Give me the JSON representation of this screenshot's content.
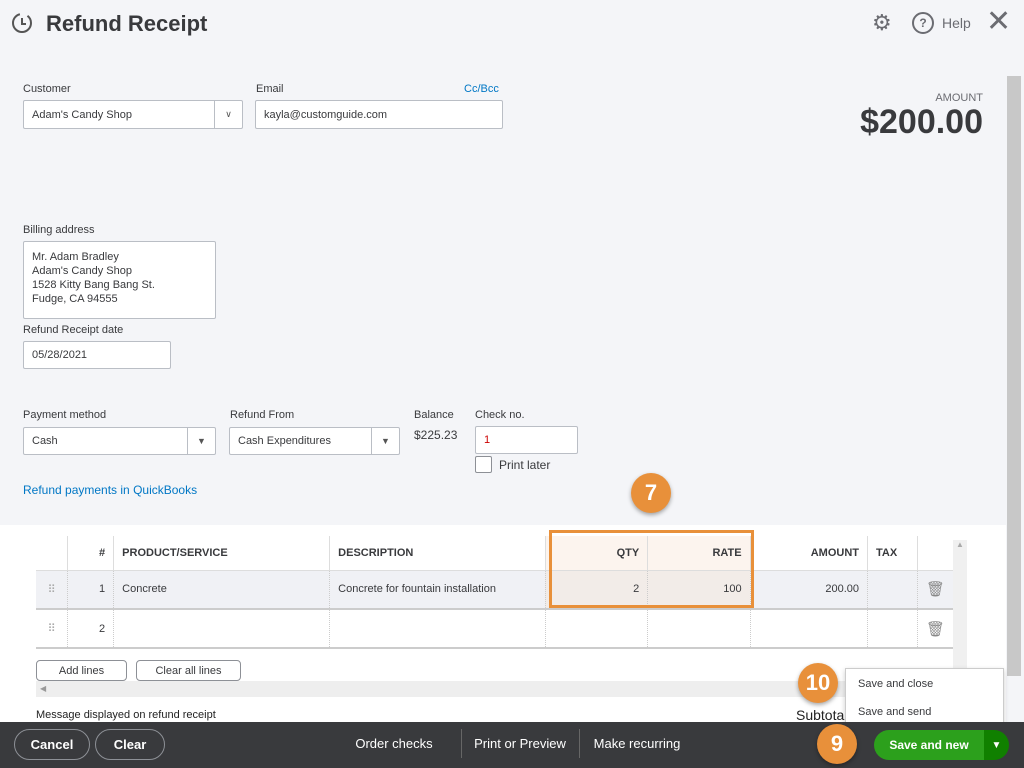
{
  "header": {
    "title": "Refund Receipt",
    "help": "Help"
  },
  "form": {
    "customer_label": "Customer",
    "customer": "Adam's Candy Shop",
    "email_label": "Email",
    "email": "kayla@customguide.com",
    "ccbcc": "Cc/Bcc",
    "amount_label": "AMOUNT",
    "amount": "$200.00",
    "billing_label": "Billing address",
    "billing": [
      "Mr. Adam Bradley",
      "Adam's Candy Shop",
      "1528 Kitty Bang Bang St.",
      "Fudge, CA  94555"
    ],
    "date_label": "Refund Receipt date",
    "date": "05/28/2021",
    "payment_label": "Payment method",
    "payment": "Cash",
    "refund_from_label": "Refund From",
    "refund_from": "Cash Expenditures",
    "balance_label": "Balance",
    "balance": "$225.23",
    "check_label": "Check no.",
    "check": "1",
    "print_later": "Print later",
    "link": "Refund payments in QuickBooks"
  },
  "table": {
    "headers": [
      "#",
      "PRODUCT/SERVICE",
      "DESCRIPTION",
      "QTY",
      "RATE",
      "AMOUNT",
      "TAX"
    ],
    "rows": [
      {
        "n": "1",
        "product": "Concrete",
        "description": "Concrete for fountain installation",
        "qty": "2",
        "rate": "100",
        "amount": "200.00"
      },
      {
        "n": "2",
        "product": "",
        "description": "",
        "qty": "",
        "rate": "",
        "amount": ""
      }
    ],
    "add_lines": "Add lines",
    "clear_lines": "Clear all lines"
  },
  "message_label": "Message displayed on refund receipt",
  "subtotal": "Subtotal",
  "menu": {
    "items": [
      "Save and close",
      "Save and send"
    ]
  },
  "footer": {
    "cancel": "Cancel",
    "clear": "Clear",
    "order_checks": "Order checks",
    "print": "Print or Preview",
    "recurring": "Make recurring",
    "save_new": "Save and new"
  },
  "callouts": [
    "7",
    "9",
    "10"
  ],
  "colors": {
    "accent": "#e8903a",
    "save": "#2ca01c",
    "link": "#0077c5",
    "footer": "#393a3d"
  }
}
